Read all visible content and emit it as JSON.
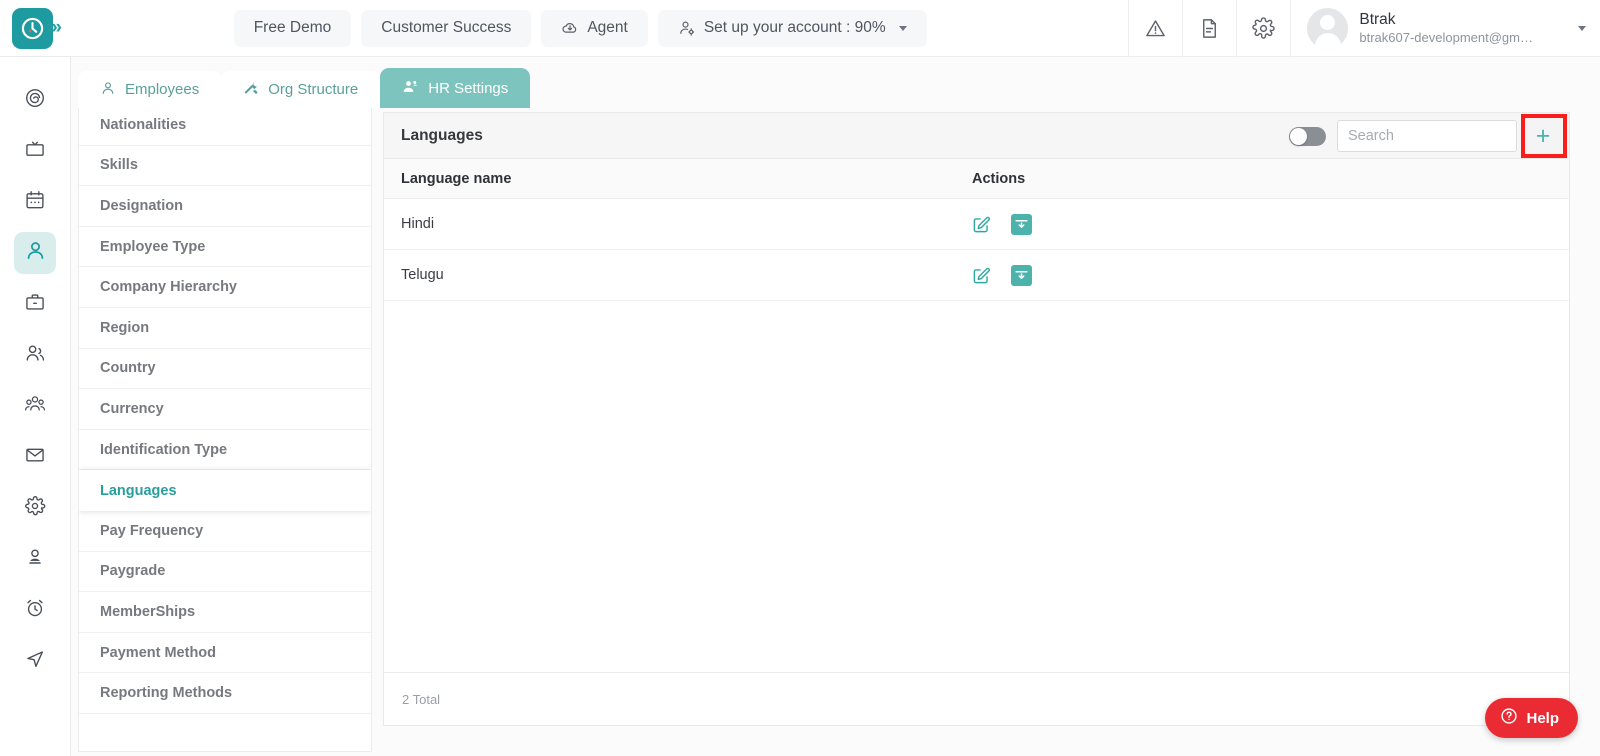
{
  "header": {
    "logo_icon": "clock-logo-icon",
    "expand_icon": "chevrons-right-icon",
    "buttons": [
      {
        "label": "Free Demo",
        "icon": null
      },
      {
        "label": "Customer Success",
        "icon": null
      },
      {
        "label": "Agent",
        "icon": "cloud-download-icon"
      },
      {
        "label": "Set up your account : 90%",
        "icon": "user-gear-icon",
        "has_caret": true
      }
    ],
    "icons": [
      {
        "name": "warning-triangle-icon"
      },
      {
        "name": "document-icon"
      },
      {
        "name": "gear-icon"
      }
    ],
    "user": {
      "name": "Btrak",
      "email": "btrak607-development@gm…",
      "avatar_icon": "avatar-placeholder-icon",
      "caret_icon": "chevron-down-icon"
    }
  },
  "rail": {
    "items": [
      {
        "name": "dashboard-spiral-icon",
        "active": false
      },
      {
        "name": "monitor-icon",
        "active": false
      },
      {
        "name": "calendar-icon",
        "active": false
      },
      {
        "name": "person-icon",
        "active": true
      },
      {
        "name": "briefcase-icon",
        "active": false
      },
      {
        "name": "two-people-icon",
        "active": false
      },
      {
        "name": "group-people-icon",
        "active": false
      },
      {
        "name": "envelope-icon",
        "active": false
      },
      {
        "name": "gear-icon",
        "active": false
      },
      {
        "name": "user-filled-icon",
        "active": false
      },
      {
        "name": "alarm-clock-icon",
        "active": false
      },
      {
        "name": "send-icon",
        "active": false
      }
    ]
  },
  "tabs": [
    {
      "label": "Employees",
      "icon": "user-outline-icon",
      "active": false
    },
    {
      "label": "Org Structure",
      "icon": "tools-icon",
      "active": false
    },
    {
      "label": "HR Settings",
      "icon": "people-gear-icon",
      "active": true
    }
  ],
  "settings_list": [
    {
      "label": "Nationalities",
      "active": false
    },
    {
      "label": "Skills",
      "active": false
    },
    {
      "label": "Designation",
      "active": false
    },
    {
      "label": "Employee Type",
      "active": false
    },
    {
      "label": "Company Hierarchy",
      "active": false
    },
    {
      "label": "Region",
      "active": false
    },
    {
      "label": "Country",
      "active": false
    },
    {
      "label": "Currency",
      "active": false
    },
    {
      "label": "Identification Type",
      "active": false
    },
    {
      "label": "Languages",
      "active": true
    },
    {
      "label": "Pay Frequency",
      "active": false
    },
    {
      "label": "Paygrade",
      "active": false
    },
    {
      "label": "MemberShips",
      "active": false
    },
    {
      "label": "Payment Method",
      "active": false
    },
    {
      "label": "Reporting Methods",
      "active": false
    }
  ],
  "panel": {
    "title": "Languages",
    "toggle": {
      "name": "show-archived-toggle",
      "state": "off"
    },
    "search": {
      "placeholder": "Search",
      "value": ""
    },
    "add_button": {
      "label": "+",
      "highlighted": true,
      "highlight_color": "#fb1c1c"
    },
    "columns": {
      "name": "Language name",
      "actions": "Actions"
    },
    "rows": [
      {
        "name": "Hindi",
        "edit_icon": "edit-square-icon",
        "archive_icon": "archive-down-icon"
      },
      {
        "name": "Telugu",
        "edit_icon": "edit-square-icon",
        "archive_icon": "archive-down-icon"
      }
    ],
    "footer_total": "2 Total"
  },
  "help_widget": {
    "label": "Help",
    "icon": "question-circle-icon",
    "color": "#eb2b34"
  },
  "theme": {
    "accent": "#2a9d9e",
    "tab_active": "#7cc4bd",
    "rail_active_bg": "#d9eeec",
    "highlight": "#fb1c1c"
  }
}
